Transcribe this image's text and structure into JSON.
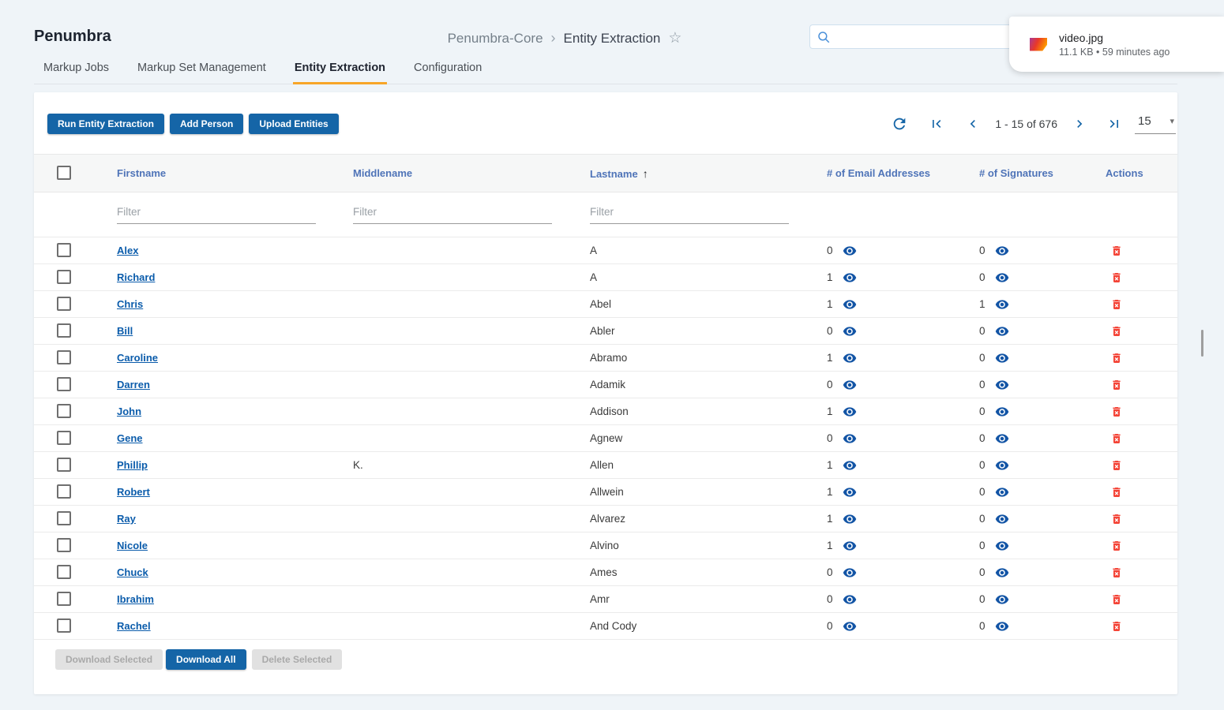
{
  "app": {
    "title": "Penumbra"
  },
  "breadcrumb": {
    "parent": "Penumbra-Core",
    "current": "Entity Extraction"
  },
  "icons": {
    "breadcrumb_separator": "›",
    "favorite_star": "☆",
    "sort_ascending": "↑",
    "caret_down": "▾"
  },
  "search": {
    "placeholder": ""
  },
  "notification": {
    "filename": "video.jpg",
    "meta": "11.1 KB • 59 minutes ago"
  },
  "tabs": [
    {
      "label": "Markup Jobs"
    },
    {
      "label": "Markup Set Management"
    },
    {
      "label": "Entity Extraction"
    },
    {
      "label": "Configuration"
    }
  ],
  "toolbar": {
    "buttons": [
      "Run Entity Extraction",
      "Add Person",
      "Upload Entities"
    ]
  },
  "pagination": {
    "range": "1 - 15 of 676",
    "page_size": "15"
  },
  "table": {
    "columns": [
      "Firstname",
      "Middlename",
      "Lastname",
      "# of Email Addresses",
      "# of Signatures",
      "Actions"
    ],
    "sort_column": "Lastname",
    "sort_direction": "ascending",
    "filter_placeholder": "Filter",
    "rows": [
      {
        "firstname": "Alex",
        "middlename": "",
        "lastname": "A",
        "emails": 0,
        "signatures": 0
      },
      {
        "firstname": "Richard",
        "middlename": "",
        "lastname": "A",
        "emails": 1,
        "signatures": 0
      },
      {
        "firstname": "Chris",
        "middlename": "",
        "lastname": "Abel",
        "emails": 1,
        "signatures": 1
      },
      {
        "firstname": "Bill",
        "middlename": "",
        "lastname": "Abler",
        "emails": 0,
        "signatures": 0
      },
      {
        "firstname": "Caroline",
        "middlename": "",
        "lastname": "Abramo",
        "emails": 1,
        "signatures": 0
      },
      {
        "firstname": "Darren",
        "middlename": "",
        "lastname": "Adamik",
        "emails": 0,
        "signatures": 0
      },
      {
        "firstname": "John",
        "middlename": "",
        "lastname": "Addison",
        "emails": 1,
        "signatures": 0
      },
      {
        "firstname": "Gene",
        "middlename": "",
        "lastname": "Agnew",
        "emails": 0,
        "signatures": 0
      },
      {
        "firstname": "Phillip",
        "middlename": "K.",
        "lastname": "Allen",
        "emails": 1,
        "signatures": 0
      },
      {
        "firstname": "Robert",
        "middlename": "",
        "lastname": "Allwein",
        "emails": 1,
        "signatures": 0
      },
      {
        "firstname": "Ray",
        "middlename": "",
        "lastname": "Alvarez",
        "emails": 1,
        "signatures": 0
      },
      {
        "firstname": "Nicole",
        "middlename": "",
        "lastname": "Alvino",
        "emails": 1,
        "signatures": 0
      },
      {
        "firstname": "Chuck",
        "middlename": "",
        "lastname": "Ames",
        "emails": 0,
        "signatures": 0
      },
      {
        "firstname": "Ibrahim",
        "middlename": "",
        "lastname": "Amr",
        "emails": 0,
        "signatures": 0
      },
      {
        "firstname": "Rachel",
        "middlename": "",
        "lastname": "And Cody",
        "emails": 0,
        "signatures": 0
      }
    ]
  },
  "footer": {
    "download_selected": "Download Selected",
    "download_all": "Download All",
    "delete_selected": "Delete Selected"
  },
  "colors": {
    "accent_blue": "#1565a7",
    "link_blue": "#0b5cab",
    "icon_blue": "#1254a5",
    "delete_red": "#f44336",
    "tab_underline_orange": "#f7a528",
    "page_background": "#eff4f8"
  }
}
